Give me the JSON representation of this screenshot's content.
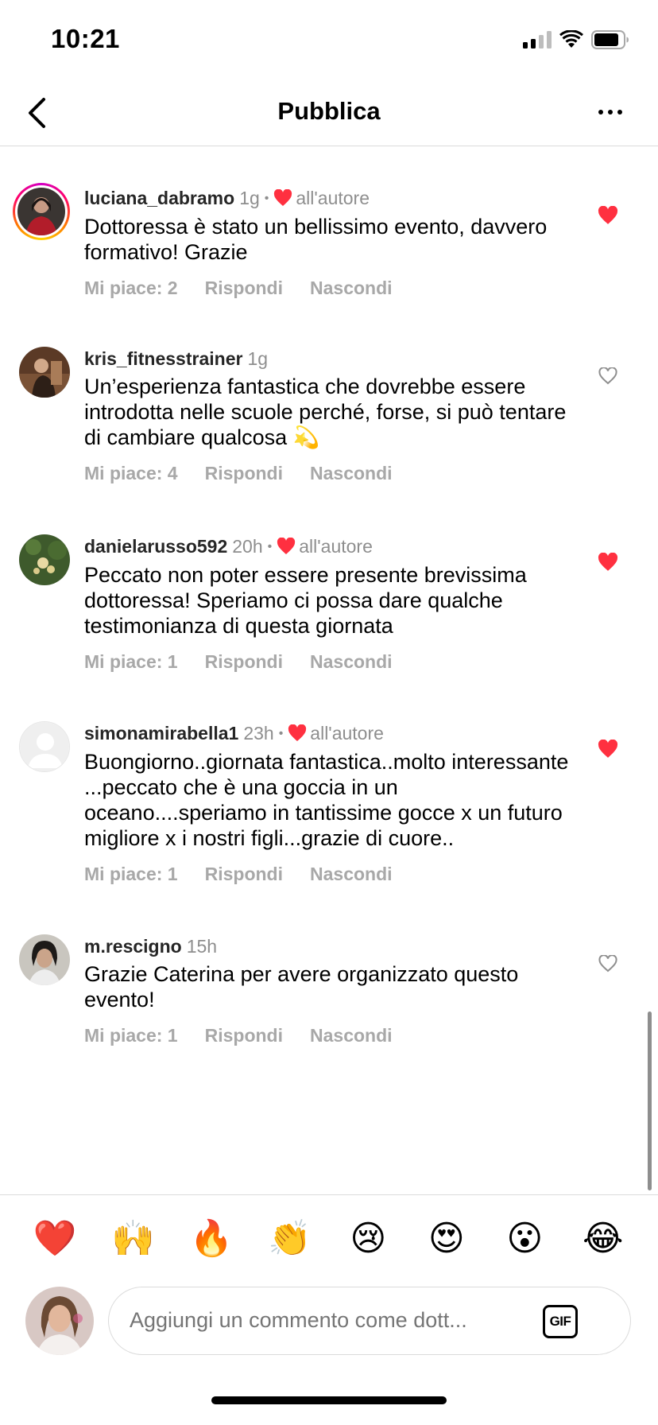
{
  "status_bar": {
    "time": "10:21"
  },
  "header": {
    "title": "Pubblica"
  },
  "comments": [
    {
      "username": "luciana_dabramo",
      "time": "1g",
      "author_liked": true,
      "author_label": "all'autore",
      "text": "Dottoressa è stato un bellissimo evento, davvero formativo! Grazie",
      "likes_label": "Mi piace: 2",
      "reply_label": "Rispondi",
      "hide_label": "Nascondi",
      "liked": true
    },
    {
      "username": "kris_fitnesstrainer",
      "time": "1g",
      "author_liked": false,
      "text": "Un’esperienza fantastica che dovrebbe essere introdotta nelle scuole perché, forse, si può tentare di cambiare qualcosa 💫",
      "likes_label": "Mi piace: 4",
      "reply_label": "Rispondi",
      "hide_label": "Nascondi",
      "liked": false
    },
    {
      "username": "danielarusso592",
      "time": "20h",
      "author_liked": true,
      "author_label": "all'autore",
      "text": "Peccato non poter essere presente brevissima dottoressa! Speriamo ci possa dare qualche testimonianza di questa giornata",
      "likes_label": "Mi piace: 1",
      "reply_label": "Rispondi",
      "hide_label": "Nascondi",
      "liked": true
    },
    {
      "username": "simonamirabella1",
      "time": "23h",
      "author_liked": true,
      "author_label": "all'autore",
      "text": "Buongiorno..giornata fantastica..molto interessante ...peccato che è una goccia in un oceano....speriamo in tantissime gocce x un futuro migliore x i nostri figli...grazie di cuore..",
      "likes_label": "Mi piace: 1",
      "reply_label": "Rispondi",
      "hide_label": "Nascondi",
      "liked": true
    },
    {
      "username": "m.rescigno",
      "time": "15h",
      "author_liked": false,
      "text": "Grazie Caterina per avere organizzato questo evento!",
      "likes_label": "Mi piace: 1",
      "reply_label": "Rispondi",
      "hide_label": "Nascondi",
      "liked": false
    }
  ],
  "emoji_bar": [
    "❤️",
    "🙌",
    "🔥",
    "👏",
    "😢",
    "😍",
    "😮",
    "😂"
  ],
  "composer": {
    "placeholder": "Aggiungi un commento come dott...",
    "gif_label": "GIF"
  },
  "colors": {
    "like_red": "#ff3040",
    "muted": "#8e8e8e",
    "action_gray": "#a8a8a8",
    "divider": "#dbdbdb"
  }
}
